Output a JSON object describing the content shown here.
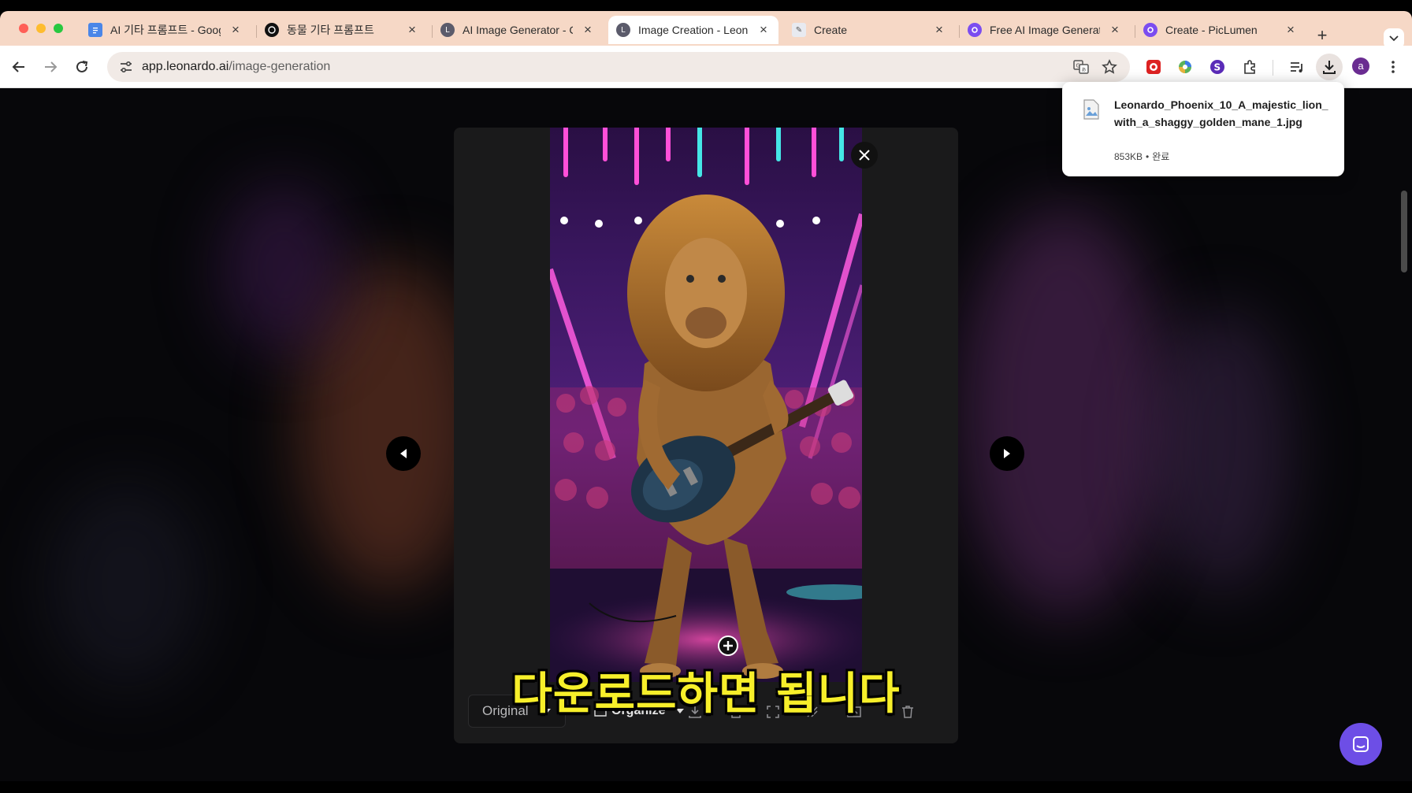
{
  "browser": {
    "tabs": [
      {
        "title": "AI 기타 프롬프트 - Googl",
        "favicon": "docs-icon"
      },
      {
        "title": "동물 기타 프롬프트",
        "favicon": "chatgpt-icon"
      },
      {
        "title": "AI Image Generator - C",
        "favicon": "leonardo-icon"
      },
      {
        "title": "Image Creation - Leon",
        "favicon": "leonardo-icon",
        "active": true
      },
      {
        "title": "Create",
        "favicon": "create-icon"
      },
      {
        "title": "Free AI Image Generat",
        "favicon": "piclumen-icon"
      },
      {
        "title": "Create - PicLumen",
        "favicon": "piclumen-icon"
      }
    ],
    "address": {
      "host": "app.leonardo.ai",
      "path": "/image-generation"
    },
    "avatar_letter": "a"
  },
  "download": {
    "filename": "Leonardo_Phoenix_10_A_majestic_lion_with_a_shaggy_golden_mane_1.jpg",
    "size": "853KB",
    "status": "완료"
  },
  "viewer": {
    "size_option": "Original",
    "organize_label": "Organize"
  },
  "subtitle": "다운로드하면 됩니다",
  "colors": {
    "tabbar": "#f6d8c6",
    "accent": "#6d4ee6",
    "subtitle": "#f7ef2a"
  }
}
